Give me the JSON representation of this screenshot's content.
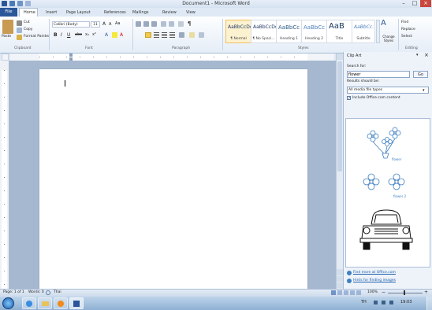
{
  "window": {
    "title": "Document1 - Microsoft Word"
  },
  "tabs": [
    "File",
    "Home",
    "Insert",
    "Page Layout",
    "References",
    "Mailings",
    "Review",
    "View"
  ],
  "ribbon": {
    "clipboard": {
      "paste": "Paste",
      "cut": "Cut",
      "copy": "Copy",
      "format_painter": "Format Painter",
      "label": "Clipboard"
    },
    "font": {
      "name": "Calibri (Body)",
      "size": "11",
      "label": "Font"
    },
    "paragraph": {
      "label": "Paragraph"
    },
    "styles": {
      "items": [
        {
          "sample": "AaBbCcDc",
          "name": "¶ Normal"
        },
        {
          "sample": "AaBbCcDc",
          "name": "¶ No Spaci..."
        },
        {
          "sample": "AaBbCc",
          "name": "Heading 1"
        },
        {
          "sample": "AaBbCc",
          "name": "Heading 2"
        },
        {
          "sample": "AaB",
          "name": "Title"
        },
        {
          "sample": "AaBbCc.",
          "name": "Subtitle"
        }
      ],
      "change_styles": "Change Styles",
      "label": "Styles"
    },
    "editing": {
      "find": "Find",
      "replace": "Replace",
      "select": "Select",
      "label": "Editing"
    }
  },
  "clipart_pane": {
    "title": "Clip Art",
    "search_label": "Search for:",
    "search_value": "flower",
    "go_button": "Go",
    "results_label": "Results should be:",
    "results_value": "All media file types",
    "include_office": "Include Office.com content",
    "results": [
      {
        "caption": "flower"
      },
      {
        "caption": "flower 2"
      },
      {
        "caption": ""
      }
    ],
    "links": [
      "Find more at Office.com",
      "Hints for finding images"
    ]
  },
  "status": {
    "page": "Page: 1 of 1",
    "words": "Words: 0",
    "language": "Thai",
    "zoom": "100%"
  },
  "taskbar": {
    "lang": "TH",
    "time": "19:03"
  },
  "colors": {
    "file_tab": "#2b579a",
    "accent": "#2b579a",
    "clip_blue": "#3d7fc1"
  }
}
